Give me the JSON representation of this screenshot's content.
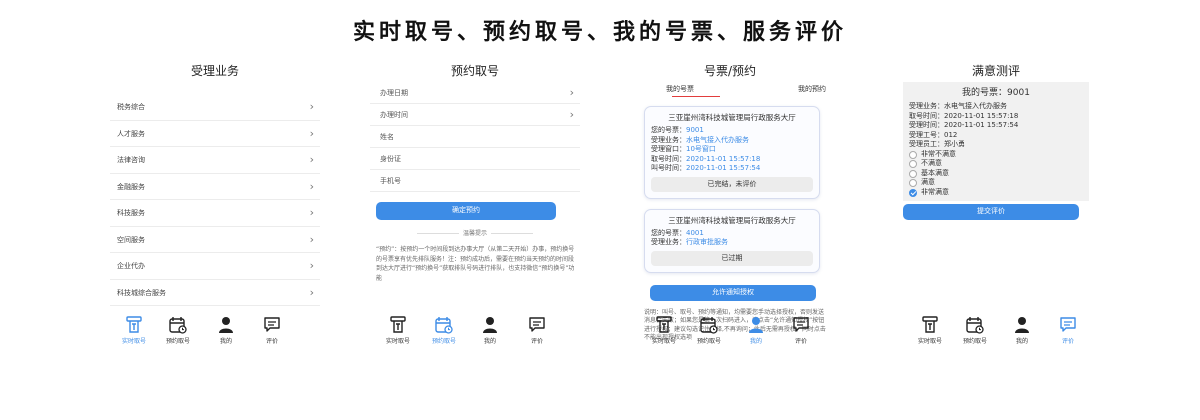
{
  "banner": "实时取号、预约取号、我的号票、服务评价",
  "colors": {
    "accent": "#3d8ce6",
    "tab_underline": "#e23d3d",
    "card_border": "#d6dcef"
  },
  "nav_labels": {
    "realtime": "实时取号",
    "reserve": "预约取号",
    "mine": "我的",
    "evaluate": "评价"
  },
  "panel1": {
    "title": "受理业务",
    "items": [
      "税务综合",
      "人才服务",
      "法律咨询",
      "金融服务",
      "科技服务",
      "空间服务",
      "企业代办",
      "科技城综合服务"
    ]
  },
  "panel2": {
    "title": "预约取号",
    "fields": [
      "办理日期",
      "办理时间",
      "姓名",
      "身份证",
      "手机号"
    ],
    "confirm": "确定预约",
    "tips_title": "温馨提示",
    "tips_text": "“预约”：按预约一个时间段到达办事大厅（从第二天开始）办事，预约换号的号票享有优先排队服务！注：预约成功后，需要在预约当天预约的时间段到达大厅进行“预约换号”获取排队号码进行排队，也支持微信“预约换号”功能"
  },
  "panel3": {
    "title": "号票/预约",
    "tab_mine": "我的号票",
    "tab_reserve": "我的预约",
    "ticket1": {
      "hall": "三亚崖州湾科技城管理局行政服务大厅",
      "num_label": "您的号票：",
      "num": "9001",
      "biz_label": "受理业务：",
      "biz": "水电气接入代办服务",
      "win_label": "受理窗口：",
      "win": "10号窗口",
      "take_label": "取号时间：",
      "take": "2020-11-01 15:57:18",
      "call_label": "叫号时间：",
      "call": "2020-11-01 15:57:54",
      "status": "已完结，未评价"
    },
    "ticket2": {
      "hall": "三亚崖州湾科技城管理局行政服务大厅",
      "num_label": "您的号票：",
      "num": "4001",
      "biz_label": "受理业务：",
      "biz": "行政审批服务",
      "status": "已过期"
    },
    "allow_btn": "允许通知授权",
    "explain": "说明：叫号、取号、预约等通知，均需要您手动选择授权，否则发送消息会失败；如果您是第一次扫码进入，请点击“允许通知授权”按钮进行授权；建议勾选记住选择,不再询问；此后无需再授权，同时点击不能出现授权选项"
  },
  "panel4": {
    "title": "满意测评",
    "num_line": "我的号票：9001",
    "lines": [
      "受理业务：水电气接入代办服务",
      "取号时间：2020-11-01 15:57:18",
      "受理时间：2020-11-01 15:57:54",
      "受理工号：012",
      "受理员工：郑小勇"
    ],
    "options": [
      "非常不满意",
      "不满意",
      "基本满意",
      "满意",
      "非常满意"
    ],
    "selected_option": "非常满意",
    "submit": "提交评价"
  }
}
